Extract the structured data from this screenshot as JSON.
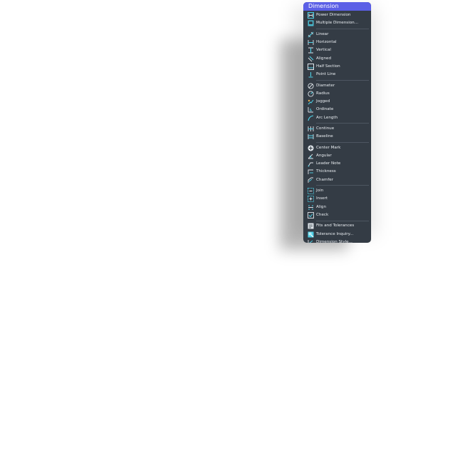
{
  "menu": {
    "title": "Dimension",
    "groups": [
      [
        {
          "label": "Power Dimension",
          "icon": "power-dimension-icon"
        },
        {
          "label": "Multiple Dimension...",
          "icon": "multiple-dimension-icon"
        }
      ],
      [
        {
          "label": "Linear",
          "icon": "linear-icon"
        },
        {
          "label": "Horizontal",
          "icon": "horizontal-icon"
        },
        {
          "label": "Vertical",
          "icon": "vertical-icon"
        },
        {
          "label": "Aligned",
          "icon": "aligned-icon"
        },
        {
          "label": "Half Section",
          "icon": "half-section-icon"
        },
        {
          "label": "Point Line",
          "icon": "point-line-icon"
        }
      ],
      [
        {
          "label": "Diameter",
          "icon": "diameter-icon"
        },
        {
          "label": "Radius",
          "icon": "radius-icon"
        },
        {
          "label": "Jogged",
          "icon": "jogged-icon"
        },
        {
          "label": "Ordinate",
          "icon": "ordinate-icon"
        },
        {
          "label": "Arc Length",
          "icon": "arc-length-icon"
        }
      ],
      [
        {
          "label": "Continue",
          "icon": "continue-icon"
        },
        {
          "label": "Baseline",
          "icon": "baseline-icon"
        }
      ],
      [
        {
          "label": "Center Mark",
          "icon": "center-mark-icon"
        },
        {
          "label": "Angular",
          "icon": "angular-icon"
        },
        {
          "label": "Leader Note",
          "icon": "leader-note-icon"
        },
        {
          "label": "Thickness",
          "icon": "thickness-icon"
        },
        {
          "label": "Chamfer",
          "icon": "chamfer-icon"
        }
      ],
      [
        {
          "label": "Join",
          "icon": "join-icon"
        },
        {
          "label": "Insert",
          "icon": "insert-icon"
        },
        {
          "label": "Align",
          "icon": "align-icon"
        },
        {
          "label": "Check",
          "icon": "check-icon"
        }
      ],
      [
        {
          "label": "Fits and Tolerances",
          "icon": "fits-tolerances-icon"
        },
        {
          "label": "Tolerance Inquiry...",
          "icon": "tolerance-inquiry-icon"
        },
        {
          "label": "Dimension Style...",
          "icon": "dimension-style-icon"
        }
      ]
    ]
  },
  "colors": {
    "title_bar": "#5b5fe6",
    "menu_background": "#343c45",
    "item_text": "#e9edf1",
    "icon_accent": "#4fd0e6",
    "separator": "#4d5661"
  }
}
